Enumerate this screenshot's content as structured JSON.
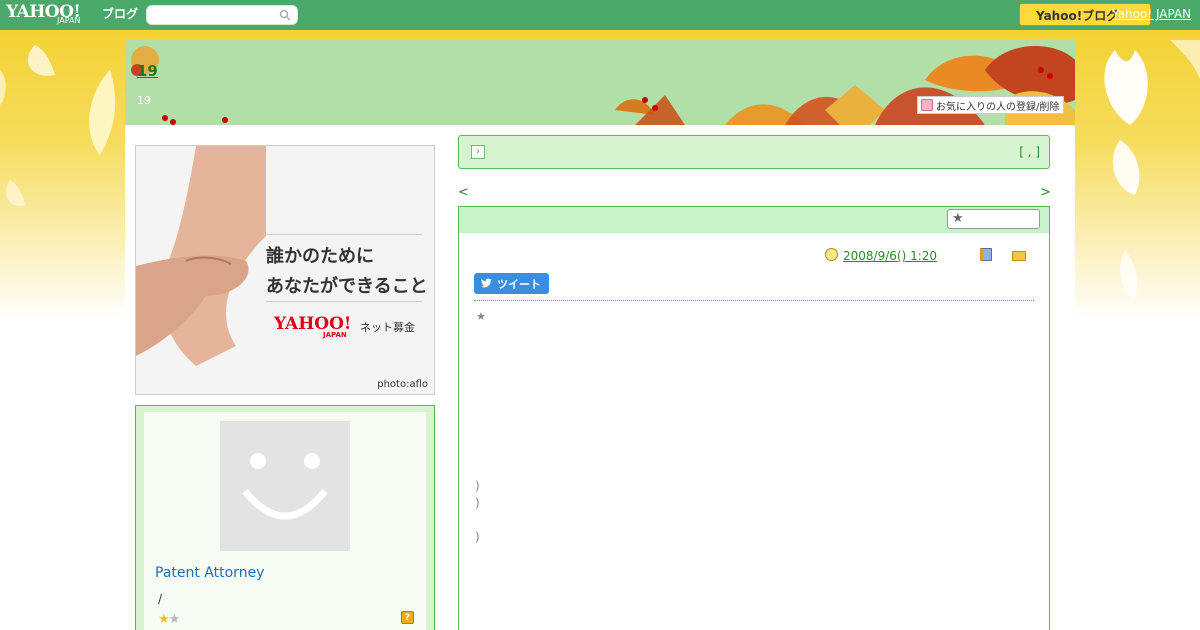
{
  "topbar": {
    "logo_text": "YAHOO!",
    "logo_sub": "JAPAN",
    "logo_blog": "ブログ",
    "search_placeholder": "",
    "yahoo_button": "Yahoo!ブログ",
    "yahoo_link": "Yahoo! JAPAN"
  },
  "header": {
    "title": "19",
    "subtitle": "19",
    "fav_button": "お気に入りの人の登録/削除"
  },
  "banner": {
    "line1": "誰かのために",
    "line2": "あなたができること",
    "brand": "YAHOO!",
    "brand_sub": "JAPAN",
    "service": "ネット募金",
    "credit": "photo:aflo"
  },
  "profile": {
    "name": "Patent Attorney",
    "slash": "/",
    "stars_filled": "★",
    "stars_empty": "★",
    "help": "?"
  },
  "notice": {
    "icon": "›",
    "bracket": "[ , ]"
  },
  "nav": {
    "prev": "<",
    "next": ">"
  },
  "article": {
    "star_button": "★",
    "date": "2008/9/6()  1:20",
    "tweet": "ツイート",
    "body_star": "★",
    "paren1": ")",
    "paren2": ")",
    "paren3": ")"
  },
  "colors": {
    "topbar": "#4aa86a",
    "header": "#b2dfa8",
    "link": "#2a8a2a",
    "accent_yellow": "#ffd93a"
  }
}
